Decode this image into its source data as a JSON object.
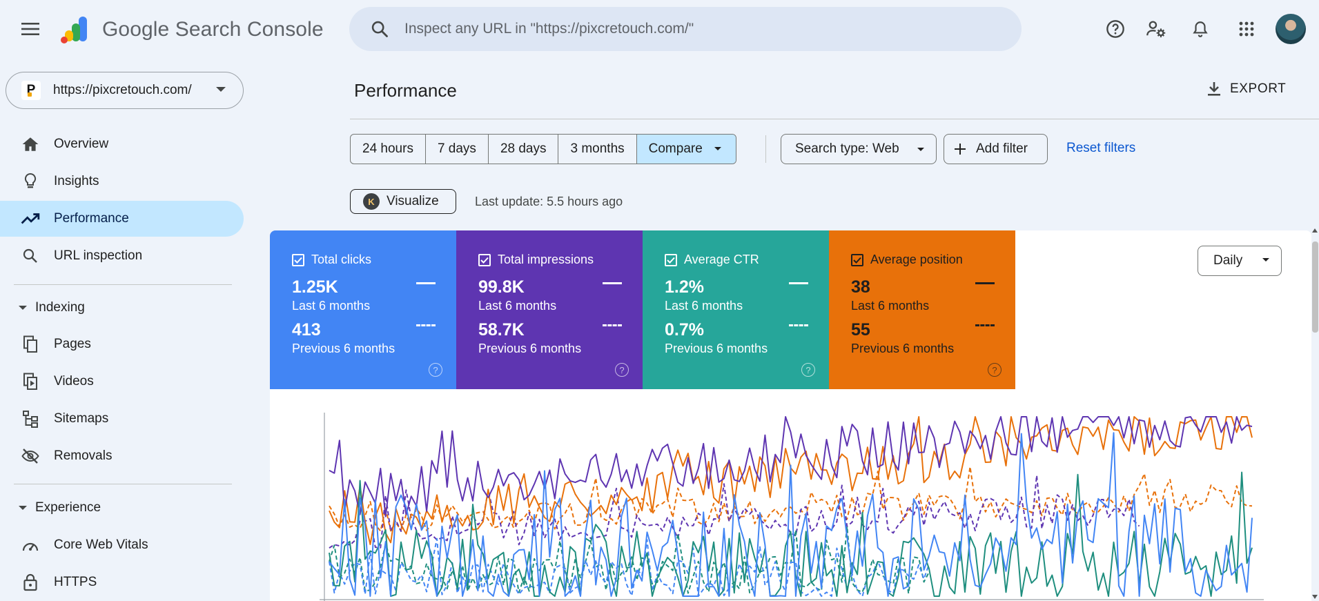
{
  "header": {
    "title_brand": "Google",
    "title_product": "Search Console",
    "search_placeholder": "Inspect any URL in \"https://pixcretouch.com/\""
  },
  "sidebar": {
    "property": "https://pixcretouch.com/",
    "items": [
      {
        "label": "Overview",
        "icon": "home-icon"
      },
      {
        "label": "Insights",
        "icon": "lightbulb-icon"
      },
      {
        "label": "Performance",
        "icon": "trending-up-icon",
        "active": true
      },
      {
        "label": "URL inspection",
        "icon": "search-icon"
      }
    ],
    "indexing": {
      "label": "Indexing",
      "items": [
        {
          "label": "Pages",
          "icon": "pages-icon"
        },
        {
          "label": "Videos",
          "icon": "video-icon"
        },
        {
          "label": "Sitemaps",
          "icon": "sitemap-icon"
        },
        {
          "label": "Removals",
          "icon": "visibility-off-icon"
        }
      ]
    },
    "experience": {
      "label": "Experience",
      "items": [
        {
          "label": "Core Web Vitals",
          "icon": "speed-icon"
        },
        {
          "label": "HTTPS",
          "icon": "lock-icon"
        }
      ]
    }
  },
  "main": {
    "title": "Performance",
    "export_label": "EXPORT",
    "date_ranges": [
      "24 hours",
      "7 days",
      "28 days",
      "3 months",
      "Compare"
    ],
    "search_type": "Search type: Web",
    "add_filter": "Add filter",
    "reset_filters": "Reset filters",
    "visualize": "Visualize",
    "last_update": "Last update: 5.5 hours ago",
    "granularity": "Daily"
  },
  "metrics": [
    {
      "label": "Total clicks",
      "current": "1.25K",
      "current_period": "Last 6 months",
      "previous": "413",
      "previous_period": "Previous 6 months",
      "color": "#4285f4",
      "text_color": "#ffffff"
    },
    {
      "label": "Total impressions",
      "current": "99.8K",
      "current_period": "Last 6 months",
      "previous": "58.7K",
      "previous_period": "Previous 6 months",
      "color": "#5e35b1",
      "text_color": "#ffffff"
    },
    {
      "label": "Average CTR",
      "current": "1.2%",
      "current_period": "Last 6 months",
      "previous": "0.7%",
      "previous_period": "Previous 6 months",
      "color": "#26a69a",
      "text_color": "#ffffff"
    },
    {
      "label": "Average position",
      "current": "38",
      "current_period": "Last 6 months",
      "previous": "55",
      "previous_period": "Previous 6 months",
      "color": "#e8710a",
      "text_color": "#1f1f1f"
    }
  ],
  "colors": {
    "active_nav": "#c2e7ff",
    "link": "#0b57d0",
    "clicks": "#4285f4",
    "impressions": "#5e35b1",
    "ctr": "#1e8e7e",
    "position": "#e8710a"
  }
}
